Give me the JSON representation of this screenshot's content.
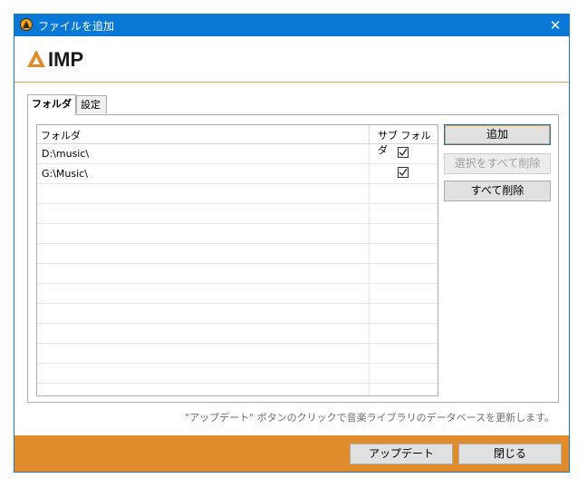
{
  "window": {
    "title": "ファイルを追加",
    "close_glyph": "✕",
    "logo_text": "IMP",
    "accent_color": "#e08c2c",
    "titlebar_color": "#0a78d7"
  },
  "tabs": [
    {
      "label": "フォルダ",
      "active": true
    },
    {
      "label": "設定",
      "active": false
    }
  ],
  "grid": {
    "columns": [
      "フォルダ",
      "サブ フォルダ"
    ],
    "rows": [
      {
        "folder": "D:\\music\\",
        "subfolders": true
      },
      {
        "folder": "G:\\Music\\",
        "subfolders": true
      }
    ]
  },
  "buttons": {
    "add": "追加",
    "remove_selected": "選択をすべて削除",
    "remove_all": "すべて削除"
  },
  "hint": "\"アップデート\" ボタンのクリックで音楽ライブラリのデータベースを更新します。",
  "footer": {
    "update": "アップデート",
    "close": "閉じる"
  }
}
